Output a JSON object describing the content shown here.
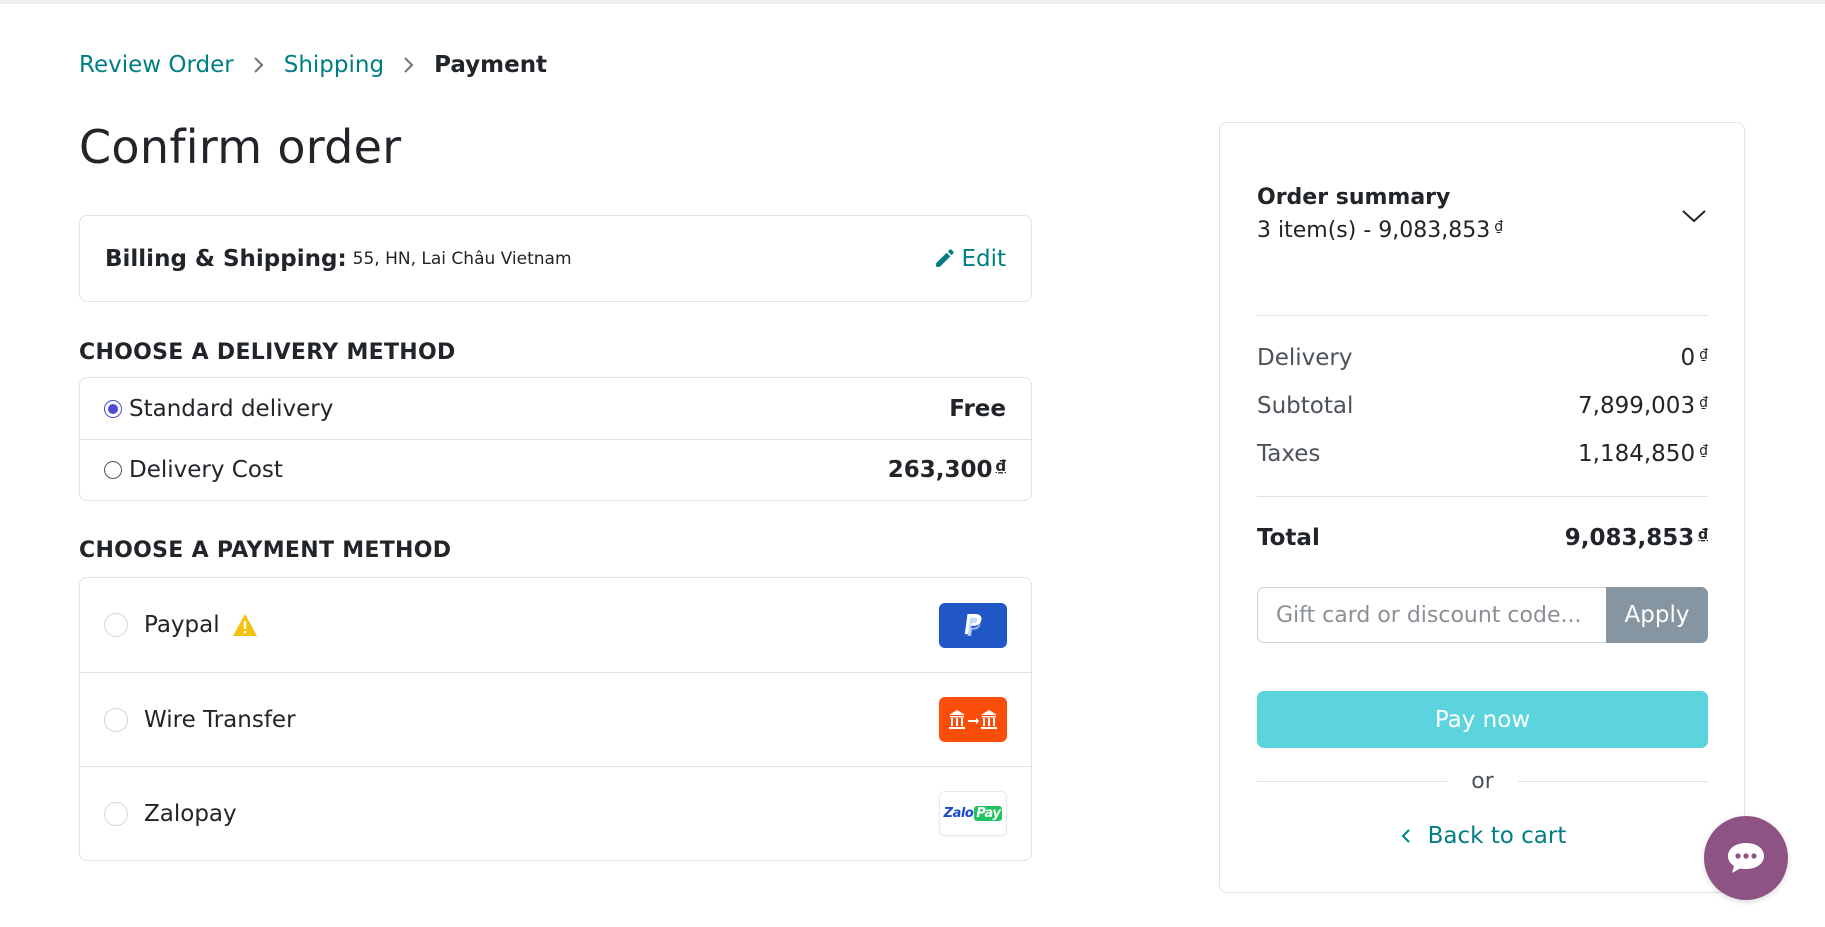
{
  "breadcrumb": {
    "items": [
      {
        "label": "Review Order"
      },
      {
        "label": "Shipping"
      },
      {
        "label": "Payment"
      }
    ]
  },
  "page": {
    "title": "Confirm order"
  },
  "billing": {
    "label": "Billing & Shipping:",
    "address": "55, HN, Lai Châu Vietnam",
    "edit_label": "Edit"
  },
  "delivery": {
    "title": "CHOOSE A DELIVERY METHOD",
    "options": [
      {
        "label": "Standard delivery",
        "price": "Free",
        "currency": "",
        "selected": true
      },
      {
        "label": "Delivery Cost",
        "price": "263,300",
        "currency": "₫",
        "selected": false
      }
    ]
  },
  "payment": {
    "title": "CHOOSE A PAYMENT METHOD",
    "methods": [
      {
        "label": "Paypal",
        "icon": "paypal-logo-icon",
        "warning_icon": "warning-icon"
      },
      {
        "label": "Wire Transfer",
        "icon": "bank-transfer-icon"
      },
      {
        "label": "Zalopay",
        "icon": "zalopay-logo-icon",
        "logo_text_a": "Zalo",
        "logo_text_b": "Pay"
      }
    ]
  },
  "summary": {
    "title": "Order summary",
    "count_label": "3 item(s) -  9,083,853",
    "currency": "₫",
    "lines": [
      {
        "label": "Delivery",
        "value": "0"
      },
      {
        "label": "Subtotal",
        "value": "7,899,003"
      },
      {
        "label": "Taxes",
        "value": "1,184,850"
      }
    ],
    "total_label": "Total",
    "total_value": "9,083,853",
    "coupon_placeholder": "Gift card or discount code...",
    "apply_label": "Apply",
    "pay_label": "Pay now",
    "or_label": "or",
    "back_label": "Back to cart"
  },
  "colors": {
    "accent": "#017e84",
    "pay_button": "#5bd4de",
    "apply_button": "#8595a2",
    "chat_button": "#8f5284",
    "radio_selected": "#4a4ad6"
  }
}
